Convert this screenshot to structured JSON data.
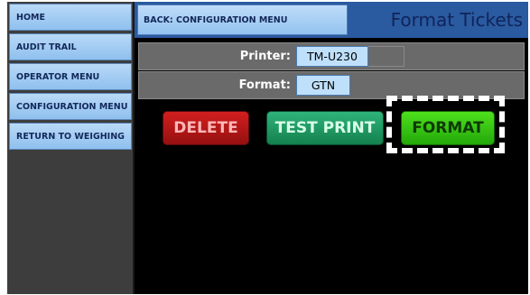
{
  "sidebar": {
    "items": [
      {
        "label": "HOME"
      },
      {
        "label": "AUDIT TRAIL"
      },
      {
        "label": "OPERATOR MENU"
      },
      {
        "label": "CONFIGURATION MENU"
      },
      {
        "label": "RETURN TO WEIGHING"
      }
    ]
  },
  "header": {
    "back_label": "BACK: CONFIGURATION MENU",
    "title": "Format Tickets"
  },
  "fields": {
    "printer": {
      "label": "Printer:",
      "value": "TM-U230"
    },
    "format": {
      "label": "Format:",
      "value": "GTN"
    }
  },
  "actions": {
    "delete_label": "DELETE",
    "test_print_label": "TEST PRINT",
    "format_label": "FORMAT"
  },
  "colors": {
    "delete": "#c21818",
    "test_print": "#22a066",
    "format": "#3fcf15",
    "header": "#2a5aa0",
    "nav_button": "#a9d0f4"
  }
}
